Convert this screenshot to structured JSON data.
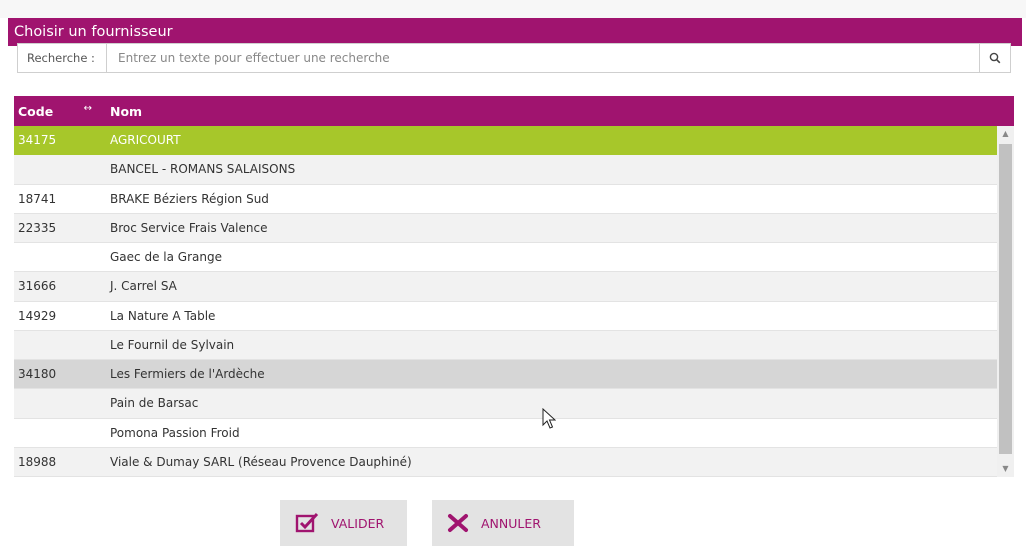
{
  "dialog": {
    "title": "Choisir un fournisseur"
  },
  "search": {
    "label": "Recherche :",
    "placeholder": "Entrez un texte pour effectuer une recherche",
    "value": "",
    "button_icon": "search-icon"
  },
  "grid": {
    "columns": [
      {
        "label": "Code"
      },
      {
        "label": "Nom"
      }
    ],
    "rows": [
      {
        "code": "34175",
        "name": "AGRICOURT",
        "state": "selected"
      },
      {
        "code": "",
        "name": "BANCEL - ROMANS SALAISONS",
        "state": ""
      },
      {
        "code": "18741",
        "name": "BRAKE Béziers Région Sud",
        "state": ""
      },
      {
        "code": "22335",
        "name": "Broc Service Frais Valence",
        "state": ""
      },
      {
        "code": "",
        "name": "Gaec de la Grange",
        "state": ""
      },
      {
        "code": "31666",
        "name": "J. Carrel SA",
        "state": ""
      },
      {
        "code": "14929",
        "name": "La Nature A Table",
        "state": ""
      },
      {
        "code": "",
        "name": "Le Fournil de Sylvain",
        "state": ""
      },
      {
        "code": "34180",
        "name": "Les Fermiers de l'Ardèche",
        "state": "hover"
      },
      {
        "code": "",
        "name": "Pain de Barsac",
        "state": ""
      },
      {
        "code": "",
        "name": "Pomona Passion Froid",
        "state": ""
      },
      {
        "code": "18988",
        "name": "Viale & Dumay SARL (Réseau Provence Dauphiné)",
        "state": ""
      }
    ]
  },
  "buttons": {
    "ok_label": "VALIDER",
    "ok_icon": "checkbox-check-icon",
    "cancel_label": "ANNULER",
    "cancel_icon": "close-x-icon"
  },
  "colors": {
    "brand": "#a0146f",
    "selected_row": "#a7c72a",
    "hover_row": "#d6d6d6",
    "button_bg": "#e3e3e3"
  }
}
